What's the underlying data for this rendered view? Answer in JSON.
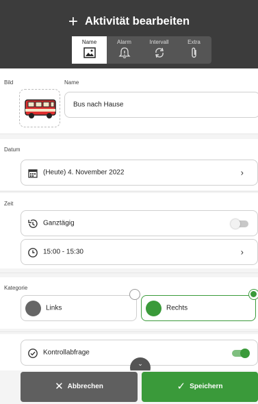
{
  "header": {
    "title": "Aktivität bearbeiten",
    "tabs": [
      {
        "label": "Name",
        "icon": "image-icon",
        "active": true
      },
      {
        "label": "Alarm",
        "icon": "bell-icon",
        "active": false
      },
      {
        "label": "Intervall",
        "icon": "repeat-icon",
        "active": false
      },
      {
        "label": "Extra",
        "icon": "paperclip-icon",
        "active": false
      }
    ]
  },
  "name_section": {
    "image_label": "Bild",
    "name_label": "Name",
    "name_value": "Bus nach Hause",
    "image_icon": "bus-icon"
  },
  "date_section": {
    "label": "Datum",
    "value": "(Heute) 4. November 2022"
  },
  "time_section": {
    "label": "Zeit",
    "allday_label": "Ganztägig",
    "allday_on": false,
    "time_value": "15:00 - 15:30"
  },
  "category_section": {
    "label": "Kategorie",
    "left_label": "Links",
    "right_label": "Rechts",
    "selected": "Rechts",
    "left_color": "#666666",
    "right_color": "#3a9a3a"
  },
  "control_section": {
    "label": "Kontrollabfrage",
    "on": true
  },
  "footer": {
    "cancel_label": "Abbrechen",
    "save_label": "Speichern",
    "cancel_color": "#5f5f5f",
    "save_color": "#3a9a3a"
  }
}
